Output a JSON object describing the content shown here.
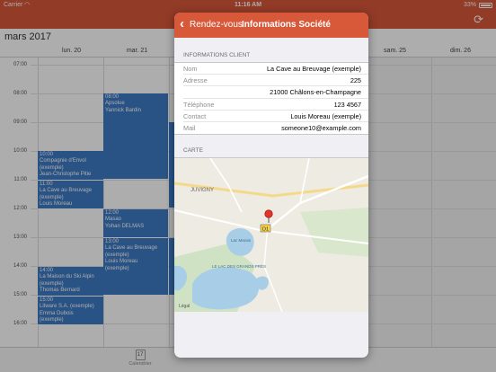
{
  "status_bar": {
    "carrier": "Carrier",
    "time": "11:16 AM",
    "battery": "33%"
  },
  "calendar": {
    "month": "mars 2017",
    "days": [
      "lun. 20",
      "mar. 21",
      "sam. 25",
      "dim. 26"
    ],
    "hours": [
      "07:00",
      "08:00",
      "09:00",
      "10:00",
      "11:00",
      "12:00",
      "13:00",
      "14:00",
      "15:00",
      "16:00"
    ],
    "events": [
      {
        "title": "08:00",
        "lines": [
          "Apsolue",
          "Yannick Bardin"
        ]
      },
      {
        "title": "10:00",
        "lines": [
          "Compagnie d'Envol",
          "(exemple)",
          "Jean-Christophe Pitie"
        ]
      },
      {
        "title": "11:00",
        "lines": [
          "La Cave au Breuvage",
          "(exemple)",
          "Louis Moreau"
        ]
      },
      {
        "title": "12:00",
        "lines": [
          "Masao",
          "Yohan DELMAS"
        ]
      },
      {
        "title": "13:00",
        "lines": [
          "La Cave au Breuvage",
          "(exemple)",
          "Louis Moreau",
          "(exemple)"
        ]
      },
      {
        "title": "14:00",
        "lines": [
          "La Maison du Ski Alpin",
          "(exemple)",
          "Thomas Bernard"
        ]
      },
      {
        "title": "15:00",
        "lines": [
          "Litware S.A. (exemple)",
          "Emma Dubois",
          "(exemple)"
        ]
      }
    ]
  },
  "tabbar": {
    "calendar_label": "Calendrier",
    "calendar_day": "17"
  },
  "popover": {
    "back_label": "Rendez-vous",
    "title": "Informations Société",
    "client_section": "INFORMATIONS CLIENT",
    "rows": [
      {
        "label": "Nom",
        "value": "La Cave au Breuvage (exemple)"
      },
      {
        "label": "Adresse",
        "value": "225"
      },
      {
        "label": "",
        "value": "21000 Châlons-en-Champagne"
      },
      {
        "label": "Téléphone",
        "value": "123 4567"
      },
      {
        "label": "Contact",
        "value": "Louis Moreau (exemple)"
      },
      {
        "label": "Mail",
        "value": "someone10@example.com"
      }
    ],
    "map_section": "CARTE",
    "map": {
      "place_juvigny": "JUVIGNY",
      "route_label": "D1",
      "lake_label": "Lac Marais",
      "lake2_label": "LE LAC DES GRANDS PRÉS",
      "legal": "Légal"
    }
  },
  "colors": {
    "accent": "#d8583a",
    "event": "#3d79c5"
  }
}
